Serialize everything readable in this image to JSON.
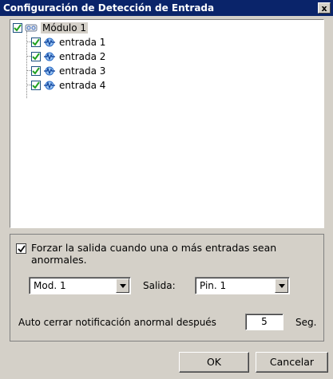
{
  "window": {
    "title": "Configuración de Detección de Entrada",
    "close_label": "x"
  },
  "tree": {
    "root": {
      "label": "Módulo 1",
      "checked": true,
      "icon": "module-icon"
    },
    "children": [
      {
        "label": "entrada 1",
        "checked": true,
        "icon": "input-signal-icon"
      },
      {
        "label": "entrada 2",
        "checked": true,
        "icon": "input-signal-icon"
      },
      {
        "label": "entrada 3",
        "checked": true,
        "icon": "input-signal-icon"
      },
      {
        "label": "entrada 4",
        "checked": true,
        "icon": "input-signal-icon"
      }
    ]
  },
  "force_output": {
    "checked": true,
    "label": "Forzar la salida cuando una o más entradas sean anormales."
  },
  "module_select": {
    "value": "Mod. 1"
  },
  "output": {
    "label": "Salida:",
    "value": "Pin. 1"
  },
  "auto_close": {
    "label": "Auto cerrar notificación anormal después",
    "value": "5",
    "unit": "Seg."
  },
  "buttons": {
    "ok": "OK",
    "cancel": "Cancelar"
  },
  "colors": {
    "titlebar": "#0a246a",
    "dialog_bg": "#d4d0c8",
    "check": "#21a121"
  }
}
